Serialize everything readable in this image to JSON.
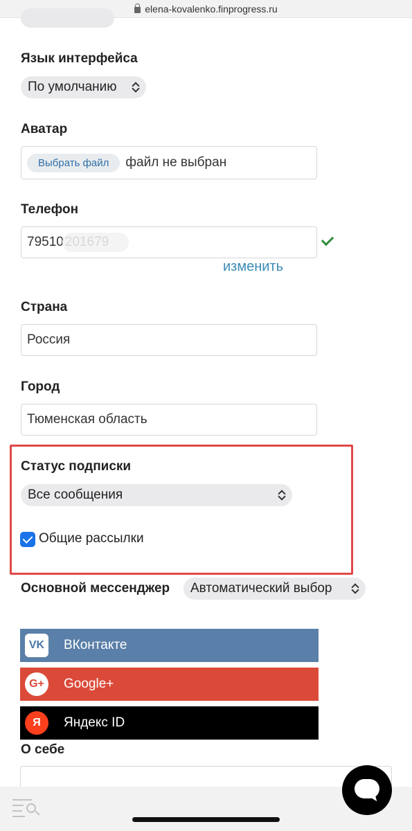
{
  "browser": {
    "url": "elena-kovalenko.finprogress.ru"
  },
  "form": {
    "language": {
      "label": "Язык интерфейса",
      "value": "По умолчанию"
    },
    "avatar": {
      "label": "Аватар",
      "button_label": "Выбрать файл",
      "status_text": "файл не выбран"
    },
    "phone": {
      "label": "Телефон",
      "value_visible": "79510",
      "value_blurred": "201679",
      "change_link": "изменить"
    },
    "country": {
      "label": "Страна",
      "value": "Россия"
    },
    "city": {
      "label": "Город",
      "value": "Тюменская область"
    },
    "subscription": {
      "label": "Статус подписки",
      "value": "Все сообщения",
      "newsletter_label": "Общие рассылки",
      "newsletter_checked": true
    },
    "messenger": {
      "label": "Основной мессенджер",
      "value": "Автоматический выбор"
    },
    "social": [
      {
        "label": "ВКонтакте",
        "icon": "vk-icon",
        "color": "#5a7fa8",
        "glyph": "VK"
      },
      {
        "label": "Google+",
        "icon": "google-plus-icon",
        "color": "#db4a39",
        "glyph": "G+"
      },
      {
        "label": "Яндекс ID",
        "icon": "yandex-icon",
        "color": "#000000",
        "glyph": "Я"
      }
    ],
    "about": {
      "label": "О себе",
      "value": ""
    }
  },
  "colors": {
    "highlight": "#e04848",
    "link": "#3a8bb5",
    "check": "#2e8b3a",
    "checkbox": "#1a73e8"
  }
}
